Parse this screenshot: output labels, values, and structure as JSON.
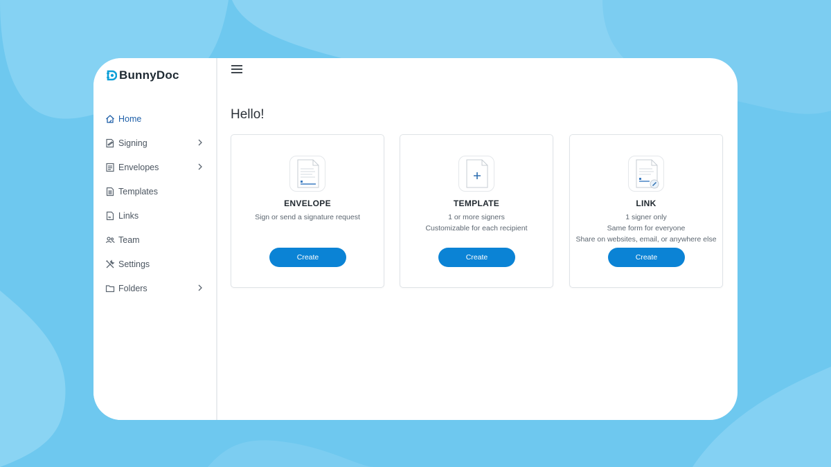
{
  "app": {
    "name": "BunnyDoc"
  },
  "colors": {
    "accent": "#0b83d5",
    "active_nav": "#1e5fa8",
    "background": "#6ec8ef"
  },
  "sidebar": {
    "items": [
      {
        "label": "Home",
        "icon": "home-icon",
        "active": true,
        "has_submenu": false
      },
      {
        "label": "Signing",
        "icon": "signing-icon",
        "active": false,
        "has_submenu": true
      },
      {
        "label": "Envelopes",
        "icon": "envelope-icon",
        "active": false,
        "has_submenu": true
      },
      {
        "label": "Templates",
        "icon": "template-icon",
        "active": false,
        "has_submenu": false
      },
      {
        "label": "Links",
        "icon": "link-icon",
        "active": false,
        "has_submenu": false
      },
      {
        "label": "Team",
        "icon": "team-icon",
        "active": false,
        "has_submenu": false
      },
      {
        "label": "Settings",
        "icon": "settings-icon",
        "active": false,
        "has_submenu": false
      },
      {
        "label": "Folders",
        "icon": "folder-icon",
        "active": false,
        "has_submenu": true
      }
    ]
  },
  "header": {
    "menu_icon": "hamburger-menu-icon"
  },
  "main": {
    "greeting": "Hello!",
    "cards": [
      {
        "title": "ENVELOPE",
        "lines": [
          "Sign or send a signature request"
        ],
        "button": "Create",
        "icon": "envelope-document-icon"
      },
      {
        "title": "TEMPLATE",
        "lines": [
          "1 or more signers",
          "Customizable for each recipient"
        ],
        "button": "Create",
        "icon": "template-add-icon"
      },
      {
        "title": "LINK",
        "lines": [
          "1 signer only",
          "Same form for everyone",
          "Share on websites, email, or anywhere else"
        ],
        "button": "Create",
        "icon": "link-document-icon"
      }
    ]
  }
}
